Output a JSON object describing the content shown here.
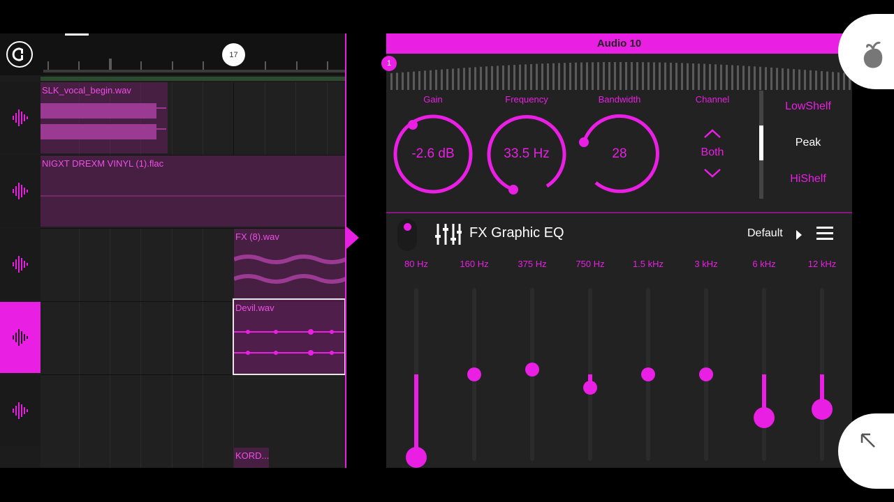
{
  "ruler": {
    "bar_number": "17"
  },
  "tracks": [
    {
      "clip": "SLK_vocal_begin.wav"
    },
    {
      "clip": "NIGXT DREXM VINYL (1).flac"
    },
    {
      "clip": "FX (8).wav"
    },
    {
      "clip": "Devil.wav",
      "selected": true
    },
    {
      "clip": "KORD..."
    }
  ],
  "channel_panel": {
    "title": "Audio 10",
    "spectrum_marker": "1",
    "params": {
      "gain": {
        "label": "Gain",
        "value": "-2.6 dB"
      },
      "frequency": {
        "label": "Frequency",
        "value": "33.5 Hz"
      },
      "bandwidth": {
        "label": "Bandwidth",
        "value": "28"
      },
      "channel": {
        "label": "Channel",
        "value": "Both"
      }
    },
    "filter_types": [
      "LowShelf",
      "Peak",
      "HiShelf"
    ],
    "selected_filter": "Peak"
  },
  "fx": {
    "title": "FX Graphic EQ",
    "preset": "Default",
    "bands": [
      {
        "label": "80 Hz",
        "level": -1.0
      },
      {
        "label": "160 Hz",
        "level": 0.0
      },
      {
        "label": "375 Hz",
        "level": 0.06
      },
      {
        "label": "750 Hz",
        "level": -0.15
      },
      {
        "label": "1.5 kHz",
        "level": 0.0
      },
      {
        "label": "3 kHz",
        "level": 0.0
      },
      {
        "label": "6 kHz",
        "level": -0.5
      },
      {
        "label": "12 kHz",
        "level": -0.4
      }
    ]
  },
  "colors": {
    "accent": "#e91fe3",
    "background": "#222222",
    "timeline_bg": "#1c1c1c"
  },
  "icons": [
    "snap-icon",
    "waveform-icon",
    "eq-sliders-icon",
    "menu-icon",
    "fl-studio-logo-icon",
    "expand-arrow-icon",
    "chevron-up-icon",
    "chevron-down-icon"
  ]
}
